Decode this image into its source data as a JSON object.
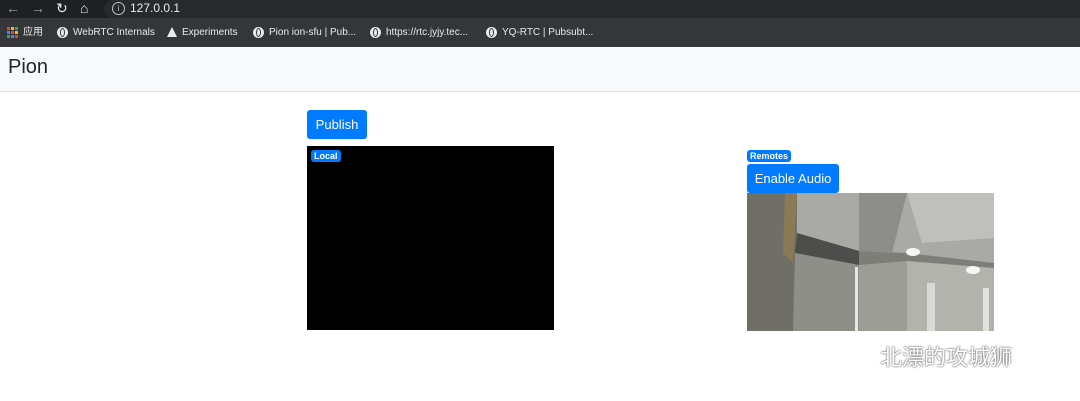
{
  "browser": {
    "url": "127.0.0.1",
    "bookmarks": [
      {
        "label": "应用",
        "icon": "apps-grid-icon"
      },
      {
        "label": "WebRTC Internals",
        "icon": "globe-icon"
      },
      {
        "label": "Experiments",
        "icon": "flask-icon"
      },
      {
        "label": "Pion ion-sfu | Pub...",
        "icon": "globe-icon"
      },
      {
        "label": "https://rtc.jyjy.tec...",
        "icon": "globe-icon"
      },
      {
        "label": "YQ-RTC | Pubsubt...",
        "icon": "globe-icon"
      }
    ]
  },
  "navbar": {
    "brand": "Pion"
  },
  "local": {
    "publish_label": "Publish",
    "badge": "Local"
  },
  "remote": {
    "badge": "Remotes",
    "enable_audio_label": "Enable Audio"
  },
  "watermark": {
    "text": "北漂的攻城狮",
    "icon": "wechat-icon"
  }
}
